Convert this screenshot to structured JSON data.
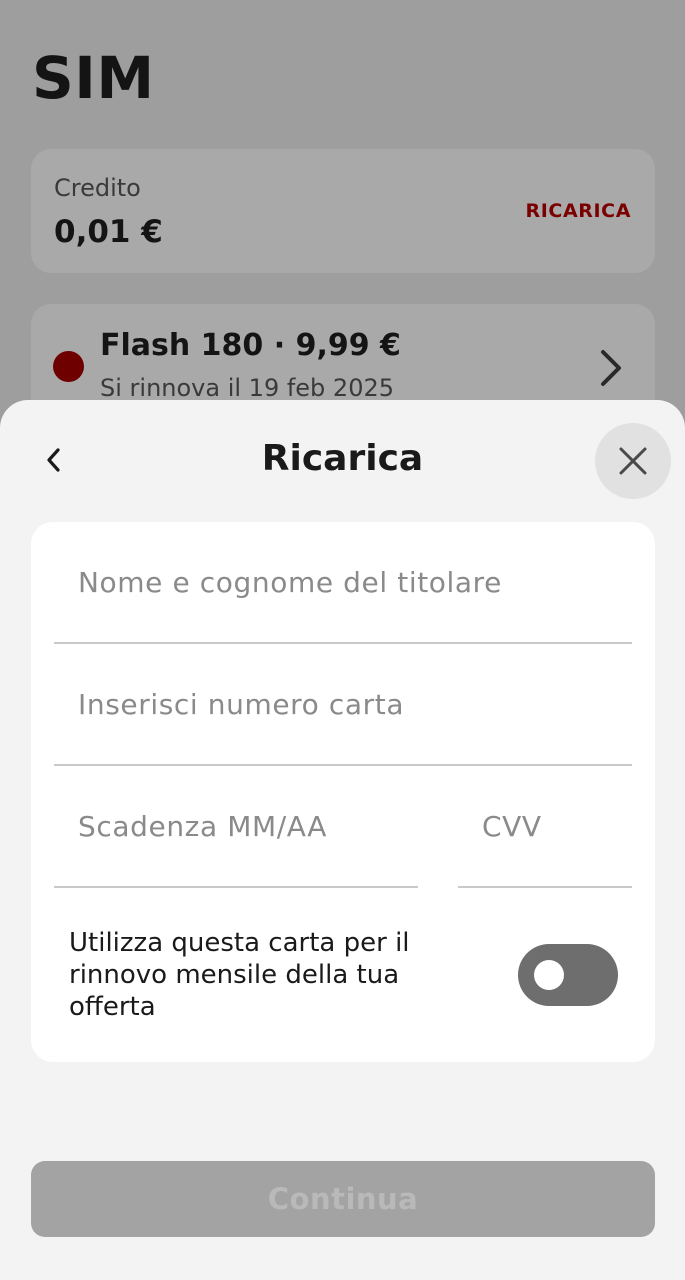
{
  "background": {
    "title": "SIM",
    "credit": {
      "label": "Credito",
      "value": "0,01 €",
      "action_label": "RICARICA"
    },
    "plan": {
      "name": "Flash 180 · 9,99 €",
      "renewal": "Si rinnova il 19 feb 2025",
      "status_color": "#6e0000",
      "icon": "chevron-right-icon"
    }
  },
  "sheet": {
    "title": "Ricarica",
    "back_icon": "chevron-left-icon",
    "close_icon": "close-icon",
    "form": {
      "holder_name": {
        "placeholder": "Nome e cognome del titolare",
        "value": ""
      },
      "card_number": {
        "placeholder": "Inserisci numero carta",
        "value": ""
      },
      "expiry": {
        "placeholder": "Scadenza MM/AA",
        "value": ""
      },
      "cvv": {
        "placeholder": "CVV",
        "value": ""
      },
      "save_card": {
        "label": "Utilizza questa carta per il rinnovo mensile della tua offerta",
        "enabled": false
      }
    },
    "continue_label": "Continua"
  },
  "colors": {
    "accent": "#7a0000",
    "sheet_background": "#f3f3f3",
    "disabled_button": "#a3a3a3"
  }
}
